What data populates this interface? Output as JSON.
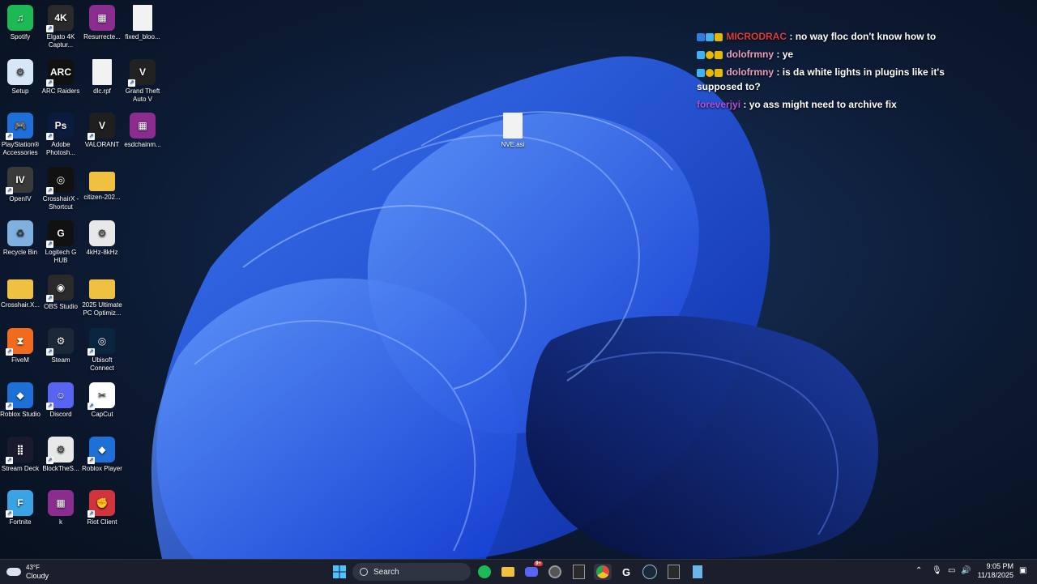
{
  "desktop": {
    "icons": [
      {
        "label": "Spotify",
        "color": "#1db954",
        "glyph": "♫",
        "shortcut": false
      },
      {
        "label": "Elgato 4K Captur...",
        "color": "#2a2a2a",
        "glyph": "4K",
        "shortcut": true
      },
      {
        "label": "Resurrecte...",
        "color": "#8a2d8e",
        "glyph": "▦",
        "shortcut": false
      },
      {
        "label": "fixed_bloo...",
        "color": "#f2f2f2",
        "glyph": "",
        "shortcut": false
      },
      {
        "label": "Setup",
        "color": "#d7e7f7",
        "glyph": "⚙",
        "shortcut": false
      },
      {
        "label": "ARC Raiders",
        "color": "#111",
        "glyph": "ARC",
        "shortcut": true
      },
      {
        "label": "dlc.rpf",
        "color": "#f2f2f2",
        "glyph": "",
        "shortcut": false
      },
      {
        "label": "Grand Theft Auto V",
        "color": "#222",
        "glyph": "V",
        "shortcut": true
      },
      {
        "label": "PlayStation® Accessories",
        "color": "#1f6fd8",
        "glyph": "🎮",
        "shortcut": true
      },
      {
        "label": "Adobe Photosh...",
        "color": "#0b1b3d",
        "glyph": "Ps",
        "shortcut": true
      },
      {
        "label": "VALORANT",
        "color": "#1f1f1f",
        "glyph": "V",
        "shortcut": true
      },
      {
        "label": "esdchainm...",
        "color": "#8a2d8e",
        "glyph": "▦",
        "shortcut": false
      },
      {
        "label": "OpenIV",
        "color": "#3a3a3a",
        "glyph": "IV",
        "shortcut": true
      },
      {
        "label": "CrosshairX - Shortcut",
        "color": "#111",
        "glyph": "◎",
        "shortcut": true
      },
      {
        "label": "citizen-202...",
        "color": "#f0c040",
        "glyph": "",
        "shortcut": false
      },
      {
        "label": "Recycle Bin",
        "color": "#7fb0df",
        "glyph": "♻",
        "shortcut": false
      },
      {
        "label": "Logitech G HUB",
        "color": "#111",
        "glyph": "G",
        "shortcut": true
      },
      {
        "label": "4kHz-8kHz",
        "color": "#e8e8e8",
        "glyph": "⚙",
        "shortcut": false
      },
      {
        "label": "Crosshair.X...",
        "color": "#f0c040",
        "glyph": "",
        "shortcut": false
      },
      {
        "label": "OBS Studio",
        "color": "#2a2a2a",
        "glyph": "◉",
        "shortcut": true
      },
      {
        "label": "2025 Ultimate PC Optimiz...",
        "color": "#f0c040",
        "glyph": "",
        "shortcut": false
      },
      {
        "label": "FiveM",
        "color": "#f26a1b",
        "glyph": "⧗",
        "shortcut": true
      },
      {
        "label": "Steam",
        "color": "#1b2838",
        "glyph": "⚙",
        "shortcut": true
      },
      {
        "label": "Ubisoft Connect",
        "color": "#0a2540",
        "glyph": "◎",
        "shortcut": true
      },
      {
        "label": "Roblox Studio",
        "color": "#1f6fd8",
        "glyph": "◆",
        "shortcut": true
      },
      {
        "label": "Discord",
        "color": "#5865f2",
        "glyph": "☺",
        "shortcut": true
      },
      {
        "label": "CapCut",
        "color": "#fff",
        "glyph": "✂",
        "shortcut": true
      },
      {
        "label": "Stream Deck",
        "color": "#1a1a2e",
        "glyph": "⣿",
        "shortcut": true
      },
      {
        "label": "BlockTheS...",
        "color": "#e8e8e8",
        "glyph": "⚙",
        "shortcut": true
      },
      {
        "label": "Roblox Player",
        "color": "#1f6fd8",
        "glyph": "◆",
        "shortcut": true
      },
      {
        "label": "Fortnite",
        "color": "#3aa3e3",
        "glyph": "F",
        "shortcut": true
      },
      {
        "label": "k",
        "color": "#8a2d8e",
        "glyph": "▦",
        "shortcut": false
      },
      {
        "label": "Riot Client",
        "color": "#d1343a",
        "glyph": "✊",
        "shortcut": true
      },
      {
        "label": "NVE.asi",
        "color": "#f2f2f2",
        "glyph": "",
        "shortcut": false
      }
    ]
  },
  "chat": {
    "messages": [
      {
        "user": "MICRODRAC",
        "user_color": "#e03a3a",
        "text": "no way floc don't know how to"
      },
      {
        "user": "dolofrmny",
        "user_color": "#e8a2c0",
        "text": "ye"
      },
      {
        "user": "dolofrmny",
        "user_color": "#e8a2c0",
        "text": "is da white lights in plugins like it's supposed to?"
      },
      {
        "user": "foreverjyi",
        "user_color": "#b44fe0",
        "text": "yo ass might need to archive fix"
      }
    ]
  },
  "taskbar": {
    "weather_temp": "43°F",
    "weather_desc": "Cloudy",
    "search_placeholder": "Search",
    "time": "9:05 PM",
    "date": "11/18/2025",
    "apps": [
      {
        "name": "start",
        "color": "#4cc2ff"
      },
      {
        "name": "spotify",
        "color": "#1db954"
      },
      {
        "name": "file-explorer",
        "color": "#f0c040"
      },
      {
        "name": "discord",
        "color": "#5865f2"
      },
      {
        "name": "obs",
        "color": "#555"
      },
      {
        "name": "epic-games",
        "color": "#2a2a2a"
      },
      {
        "name": "chrome",
        "color": "#e6a82a"
      },
      {
        "name": "logitech",
        "color": "#111"
      },
      {
        "name": "steam",
        "color": "#1b2838"
      },
      {
        "name": "epic-games-2",
        "color": "#2a2a2a"
      },
      {
        "name": "notepad",
        "color": "#6bb6e8"
      }
    ],
    "discord_badge": "9+"
  }
}
